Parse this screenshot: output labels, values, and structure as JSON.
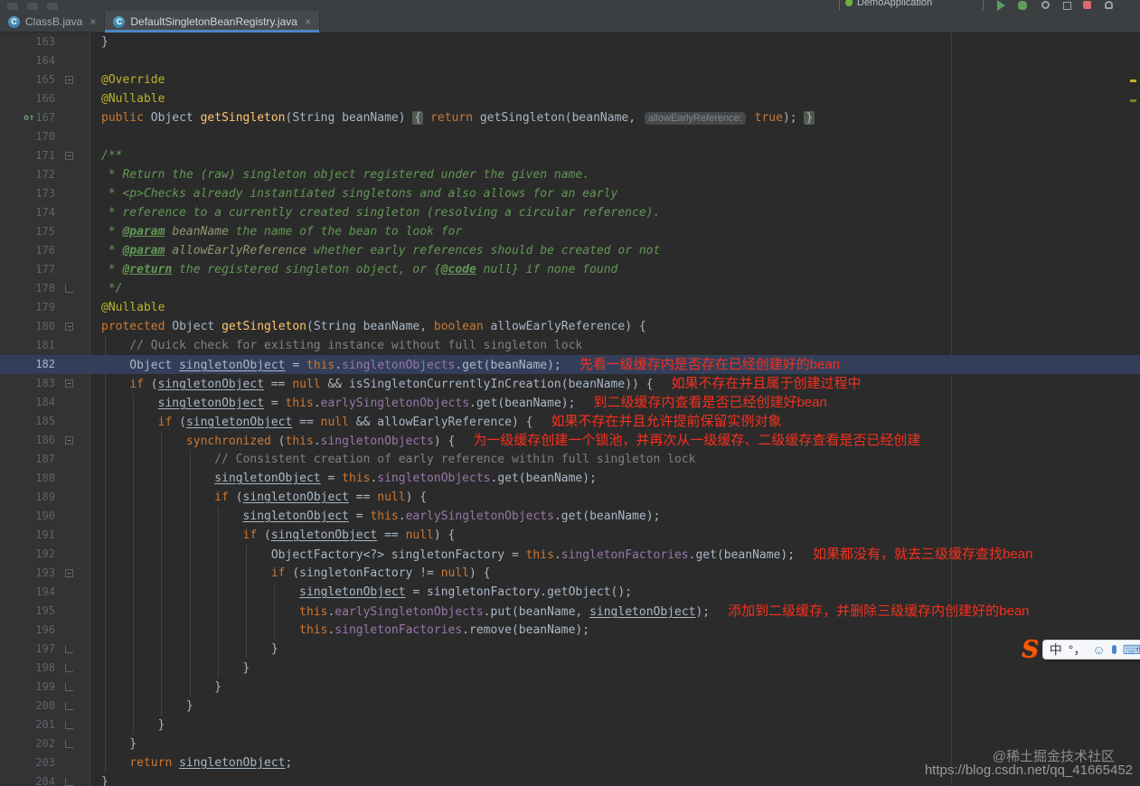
{
  "window": {
    "run_config": "DemoApplication",
    "tabs": [
      {
        "label": "ClassB.java",
        "active": false
      },
      {
        "label": "DefaultSingletonBeanRegistry.java",
        "active": true
      }
    ]
  },
  "icons": {
    "fold_start": "−",
    "override": "o↑",
    "tab_close": "×",
    "class_badge": "C"
  },
  "colors": {
    "editor_background": "#2b2b2b",
    "active_tab_underline": "#4a88c7",
    "current_line": "#333f5a",
    "annotation_red": "#f5301e"
  },
  "editor": {
    "lines": [
      {
        "no": "163",
        "segs": [
          [
            "}",
            "pln"
          ]
        ]
      },
      {
        "no": "164",
        "segs": []
      },
      {
        "no": "165",
        "fold": "start",
        "segs": [
          [
            "@Override",
            "ann"
          ]
        ]
      },
      {
        "no": "166",
        "segs": [
          [
            "@Nullable",
            "ann"
          ]
        ]
      },
      {
        "no": "167",
        "icon": "override",
        "segs": [
          [
            "public ",
            "kw"
          ],
          [
            "Object ",
            "pln"
          ],
          [
            "getSingleton",
            "dec"
          ],
          [
            "(String beanName) ",
            "pln"
          ],
          [
            "{",
            "fold"
          ],
          [
            " ",
            "pln"
          ],
          [
            "return",
            "kw"
          ],
          [
            " getSingleton(beanName, ",
            "pln"
          ],
          [
            "allowEarlyReference:",
            "hint"
          ],
          [
            " ",
            "pln"
          ],
          [
            "true",
            "kw"
          ],
          [
            "); ",
            "pln"
          ],
          [
            "}",
            "fold"
          ]
        ]
      },
      {
        "no": "170",
        "segs": []
      },
      {
        "no": "171",
        "fold": "start",
        "segs": [
          [
            "/**",
            "doc"
          ]
        ]
      },
      {
        "no": "172",
        "segs": [
          [
            " * Return the (raw) singleton object registered under the given name.",
            "doc"
          ]
        ]
      },
      {
        "no": "173",
        "segs": [
          [
            " * <p>Checks already instantiated singletons and also allows for an early",
            "doc"
          ]
        ]
      },
      {
        "no": "174",
        "segs": [
          [
            " * reference to a currently created singleton (resolving a circular reference).",
            "doc"
          ]
        ]
      },
      {
        "no": "175",
        "segs": [
          [
            " * ",
            "doc"
          ],
          [
            "@param",
            "dtag"
          ],
          [
            " ",
            "doc"
          ],
          [
            "beanName",
            "dval"
          ],
          [
            " the name of the bean to look for",
            "doc"
          ]
        ]
      },
      {
        "no": "176",
        "segs": [
          [
            " * ",
            "doc"
          ],
          [
            "@param",
            "dtag"
          ],
          [
            " ",
            "doc"
          ],
          [
            "allowEarlyReference",
            "dval"
          ],
          [
            " whether early references should be created or not",
            "doc"
          ]
        ]
      },
      {
        "no": "177",
        "segs": [
          [
            " * ",
            "doc"
          ],
          [
            "@return",
            "dtag"
          ],
          [
            " the registered singleton object, or {",
            "doc"
          ],
          [
            "@code",
            "dtag"
          ],
          [
            " null} if none found",
            "doc"
          ]
        ]
      },
      {
        "no": "178",
        "fold": "end",
        "segs": [
          [
            " */",
            "doc"
          ]
        ]
      },
      {
        "no": "179",
        "segs": [
          [
            "@Nullable",
            "ann"
          ]
        ]
      },
      {
        "no": "180",
        "fold": "start",
        "segs": [
          [
            "protected ",
            "kw"
          ],
          [
            "Object ",
            "pln"
          ],
          [
            "getSingleton",
            "dec"
          ],
          [
            "(String beanName, ",
            "pln"
          ],
          [
            "boolean",
            "kw"
          ],
          [
            " allowEarlyReference) {",
            "pln"
          ]
        ]
      },
      {
        "no": "181",
        "segs": [
          [
            "    ",
            "pln"
          ],
          [
            "// Quick check for existing instance without full singleton lock",
            "cmt"
          ]
        ]
      },
      {
        "no": "182",
        "current": true,
        "segs": [
          [
            "    Object ",
            "pln"
          ],
          [
            "singletonObject",
            "var"
          ],
          [
            " = ",
            "pln"
          ],
          [
            "this",
            "kw"
          ],
          [
            ".",
            "pln"
          ],
          [
            "singletonObjects",
            "fld"
          ],
          [
            ".get(beanName);",
            "pln"
          ]
        ],
        "note": "先看一级缓存内是否存在已经创建好的bean"
      },
      {
        "no": "183",
        "fold": "start",
        "segs": [
          [
            "    ",
            "pln"
          ],
          [
            "if",
            "kw"
          ],
          [
            " (",
            "pln"
          ],
          [
            "singletonObject",
            "var"
          ],
          [
            " == ",
            "pln"
          ],
          [
            "null",
            "kw"
          ],
          [
            " && isSingletonCurrentlyInCreation(beanName)) {",
            "pln"
          ]
        ],
        "note": "如果不存在并且属于创建过程中"
      },
      {
        "no": "184",
        "segs": [
          [
            "        ",
            "pln"
          ],
          [
            "singletonObject",
            "var"
          ],
          [
            " = ",
            "pln"
          ],
          [
            "this",
            "kw"
          ],
          [
            ".",
            "pln"
          ],
          [
            "earlySingletonObjects",
            "fld"
          ],
          [
            ".get(beanName);",
            "pln"
          ]
        ],
        "note": "到二级缓存内查看是否已经创建好bean"
      },
      {
        "no": "185",
        "segs": [
          [
            "        ",
            "pln"
          ],
          [
            "if",
            "kw"
          ],
          [
            " (",
            "pln"
          ],
          [
            "singletonObject",
            "var"
          ],
          [
            " == ",
            "pln"
          ],
          [
            "null",
            "kw"
          ],
          [
            " && allowEarlyReference) {",
            "pln"
          ]
        ],
        "note": "如果不存在并且允许提前保留实例对象"
      },
      {
        "no": "186",
        "fold": "start",
        "segs": [
          [
            "            ",
            "pln"
          ],
          [
            "synchronized",
            "kw"
          ],
          [
            " (",
            "pln"
          ],
          [
            "this",
            "kw"
          ],
          [
            ".",
            "pln"
          ],
          [
            "singletonObjects",
            "fld"
          ],
          [
            ") {",
            "pln"
          ]
        ],
        "note": "为一级缓存创建一个锁池，并再次从一级缓存、二级缓存查看是否已经创建"
      },
      {
        "no": "187",
        "segs": [
          [
            "                ",
            "pln"
          ],
          [
            "// Consistent creation of early reference within full singleton lock",
            "cmt"
          ]
        ]
      },
      {
        "no": "188",
        "segs": [
          [
            "                ",
            "pln"
          ],
          [
            "singletonObject",
            "var"
          ],
          [
            " = ",
            "pln"
          ],
          [
            "this",
            "kw"
          ],
          [
            ".",
            "pln"
          ],
          [
            "singletonObjects",
            "fld"
          ],
          [
            ".get(beanName);",
            "pln"
          ]
        ]
      },
      {
        "no": "189",
        "segs": [
          [
            "                ",
            "pln"
          ],
          [
            "if",
            "kw"
          ],
          [
            " (",
            "pln"
          ],
          [
            "singletonObject",
            "var"
          ],
          [
            " == ",
            "pln"
          ],
          [
            "null",
            "kw"
          ],
          [
            ") {",
            "pln"
          ]
        ]
      },
      {
        "no": "190",
        "segs": [
          [
            "                    ",
            "pln"
          ],
          [
            "singletonObject",
            "var"
          ],
          [
            " = ",
            "pln"
          ],
          [
            "this",
            "kw"
          ],
          [
            ".",
            "pln"
          ],
          [
            "earlySingletonObjects",
            "fld"
          ],
          [
            ".get(beanName);",
            "pln"
          ]
        ]
      },
      {
        "no": "191",
        "segs": [
          [
            "                    ",
            "pln"
          ],
          [
            "if",
            "kw"
          ],
          [
            " (",
            "pln"
          ],
          [
            "singletonObject",
            "var"
          ],
          [
            " == ",
            "pln"
          ],
          [
            "null",
            "kw"
          ],
          [
            ") {",
            "pln"
          ]
        ]
      },
      {
        "no": "192",
        "segs": [
          [
            "                        ObjectFactory<?> singletonFactory = ",
            "pln"
          ],
          [
            "this",
            "kw"
          ],
          [
            ".",
            "pln"
          ],
          [
            "singletonFactories",
            "fld"
          ],
          [
            ".get(beanName);",
            "pln"
          ]
        ],
        "note": "如果都没有，就去三级缓存查找bean"
      },
      {
        "no": "193",
        "fold": "start",
        "segs": [
          [
            "                        ",
            "pln"
          ],
          [
            "if",
            "kw"
          ],
          [
            " (singletonFactory != ",
            "pln"
          ],
          [
            "null",
            "kw"
          ],
          [
            ") {",
            "pln"
          ]
        ]
      },
      {
        "no": "194",
        "segs": [
          [
            "                            ",
            "pln"
          ],
          [
            "singletonObject",
            "var"
          ],
          [
            " = singletonFactory.getObject();",
            "pln"
          ]
        ]
      },
      {
        "no": "195",
        "segs": [
          [
            "                            ",
            "pln"
          ],
          [
            "this",
            "kw"
          ],
          [
            ".",
            "pln"
          ],
          [
            "earlySingletonObjects",
            "fld"
          ],
          [
            ".put(beanName, ",
            "pln"
          ],
          [
            "singletonObject",
            "var"
          ],
          [
            ");",
            "pln"
          ]
        ],
        "note": "添加到二级缓存，并删除三级缓存内创建好的bean"
      },
      {
        "no": "196",
        "segs": [
          [
            "                            ",
            "pln"
          ],
          [
            "this",
            "kw"
          ],
          [
            ".",
            "pln"
          ],
          [
            "singletonFactories",
            "fld"
          ],
          [
            ".remove(beanName);",
            "pln"
          ]
        ]
      },
      {
        "no": "197",
        "fold": "end",
        "segs": [
          [
            "                        }",
            "pln"
          ]
        ]
      },
      {
        "no": "198",
        "fold": "end",
        "segs": [
          [
            "                    }",
            "pln"
          ]
        ]
      },
      {
        "no": "199",
        "fold": "end",
        "segs": [
          [
            "                }",
            "pln"
          ]
        ]
      },
      {
        "no": "200",
        "fold": "end",
        "segs": [
          [
            "            }",
            "pln"
          ]
        ]
      },
      {
        "no": "201",
        "fold": "end",
        "segs": [
          [
            "        }",
            "pln"
          ]
        ]
      },
      {
        "no": "202",
        "fold": "end",
        "segs": [
          [
            "    }",
            "pln"
          ]
        ]
      },
      {
        "no": "203",
        "segs": [
          [
            "    ",
            "pln"
          ],
          [
            "return ",
            "kw"
          ],
          [
            "singletonObject",
            "var"
          ],
          [
            ";",
            "pln"
          ]
        ]
      },
      {
        "no": "204",
        "fold": "end",
        "segs": [
          [
            "}",
            "pln"
          ]
        ]
      }
    ]
  },
  "overlays": {
    "watermark_juejin": "@稀土掘金技术社区",
    "watermark_csdn": "https://blog.csdn.net/qq_41665452"
  },
  "ime": {
    "logo": "S",
    "lang": "中",
    "punct": "°，",
    "emoji": "☺",
    "keyboard": "⌨"
  }
}
